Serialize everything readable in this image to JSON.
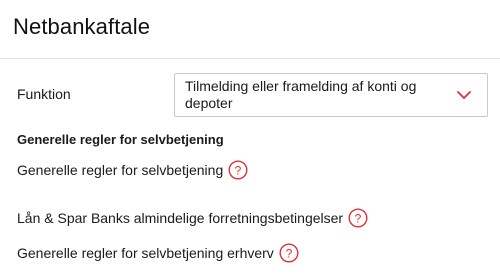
{
  "page": {
    "title": "Netbankaftale"
  },
  "function_field": {
    "label": "Funktion",
    "selected_value": "Tilmelding eller framelding af konti og depoter",
    "icon": "chevron-down-icon"
  },
  "rules_section": {
    "heading": "Generelle regler for selvbetjening",
    "links": [
      {
        "label": "Generelle regler for selvbetjening",
        "icon": "help-icon"
      },
      {
        "label": "Lån & Spar Banks almindelige forretningsbetingelser",
        "icon": "help-icon"
      },
      {
        "label": "Generelle regler for selvbetjening erhverv",
        "icon": "help-icon"
      }
    ]
  },
  "colors": {
    "accent": "#e0303a",
    "border": "#c8c8c8",
    "divider": "#e3e3e3",
    "text": "#1a1a1a"
  }
}
